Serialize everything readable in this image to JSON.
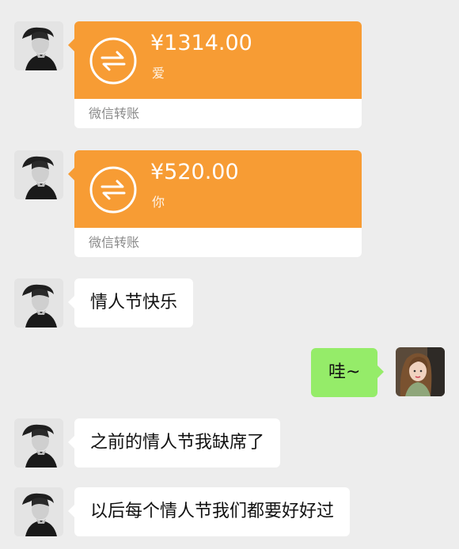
{
  "messages": [
    {
      "type": "transfer",
      "sender": "contact",
      "amount": "¥1314.00",
      "memo": "爱",
      "footer": "微信转账"
    },
    {
      "type": "transfer",
      "sender": "contact",
      "amount": "¥520.00",
      "memo": "你",
      "footer": "微信转账"
    },
    {
      "type": "text",
      "sender": "contact",
      "text": "情人节快乐"
    },
    {
      "type": "text",
      "sender": "self",
      "text": "哇~"
    },
    {
      "type": "text",
      "sender": "contact",
      "text": "之前的情人节我缺席了"
    },
    {
      "type": "text",
      "sender": "contact",
      "text": "以后每个情人节我们都要好好过"
    }
  ],
  "colors": {
    "background": "#ededed",
    "transfer_orange": "#f79c34",
    "self_bubble": "#95ec69",
    "contact_bubble": "#ffffff",
    "footer_text": "#8a8a8a"
  },
  "icons": {
    "contact_avatar": "contact-avatar-photo",
    "self_avatar": "self-avatar-photo",
    "transfer": "transfer-arrows-icon"
  }
}
